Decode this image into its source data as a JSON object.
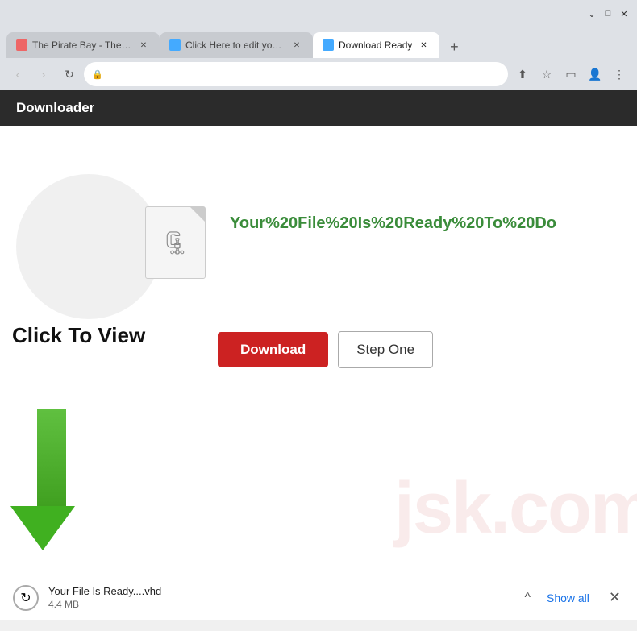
{
  "browser": {
    "title_bar": {
      "minimize_label": "−",
      "maximize_label": "□",
      "close_label": "✕",
      "chevron_down": "⌄"
    },
    "tabs": [
      {
        "id": "tab1",
        "label": "The Pirate Bay - The ga",
        "favicon_color": "#e66",
        "active": false
      },
      {
        "id": "tab2",
        "label": "Click Here to edit your t",
        "favicon_color": "#4af",
        "active": false
      },
      {
        "id": "tab3",
        "label": "Download Ready",
        "favicon_color": "#4af",
        "active": true
      }
    ],
    "new_tab_label": "+",
    "address": "",
    "nav": {
      "back": "‹",
      "forward": "›",
      "refresh": "↻"
    },
    "toolbar": {
      "share": "⬆",
      "bookmark": "☆",
      "reader": "▭",
      "profile": "👤",
      "menu": "⋮"
    }
  },
  "page": {
    "header": {
      "title": "Downloader"
    },
    "main": {
      "ready_text": "Your%20File%20Is%20Ready%20To%20Do",
      "click_to_view": "Click To View",
      "watermark": "jsk.com",
      "file_icon_char": "🗜",
      "btn_download": "Download",
      "btn_step_one": "Step One"
    },
    "download_bar": {
      "filename": "Your File Is Ready....vhd",
      "size": "4.4 MB",
      "show_all": "Show all",
      "close": "✕",
      "chevron": "^"
    }
  }
}
